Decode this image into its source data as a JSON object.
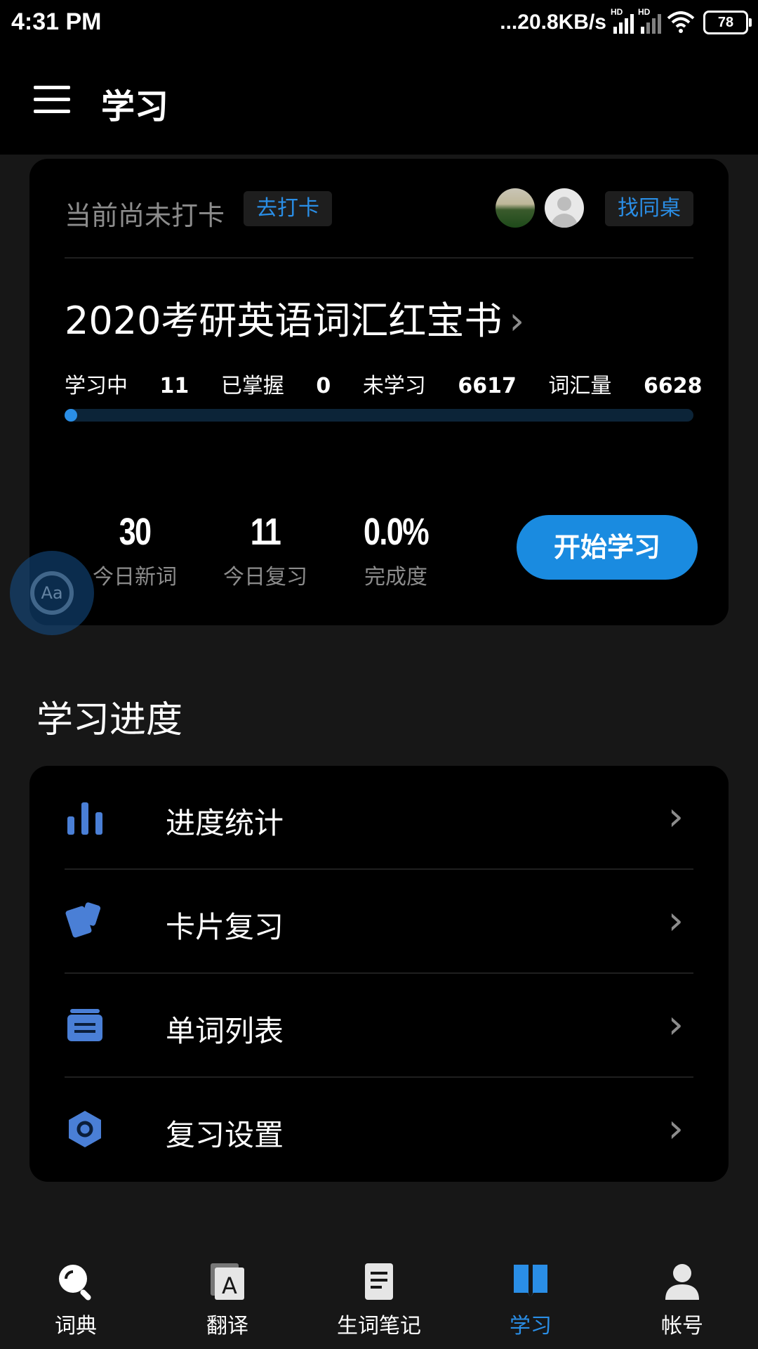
{
  "status_bar": {
    "time": "4:31 PM",
    "network_speed": "...20.8KB/s",
    "signal_label_1": "HD",
    "signal_label_2": "HD",
    "battery": "78",
    "icons": [
      "signal-icon",
      "signal-icon",
      "wifi-icon",
      "battery-icon"
    ]
  },
  "app_bar": {
    "title": "学习",
    "menu_icon": "menu-icon"
  },
  "study_card": {
    "checkin_status": "当前尚未打卡",
    "checkin_button": "去打卡",
    "find_partner_button": "找同桌",
    "book_title": "2020考研英语词汇红宝书",
    "book_chevron": "›",
    "stats": {
      "learning_label": "学习中",
      "learning_value": "11",
      "mastered_label": "已掌握",
      "mastered_value": "0",
      "unlearned_label": "未学习",
      "unlearned_value": "6617",
      "vocab_label": "词汇量",
      "vocab_value": "6628"
    },
    "progress_fraction": 0.0,
    "metrics": [
      {
        "value": "30",
        "label": "今日新词"
      },
      {
        "value": "11",
        "label": "今日复习"
      },
      {
        "value": "0.0%",
        "label": "完成度"
      }
    ],
    "start_button": "开始学习"
  },
  "progress_section": {
    "title": "学习进度",
    "items": [
      {
        "label": "进度统计",
        "icon": "bar-chart-icon"
      },
      {
        "label": "卡片复习",
        "icon": "cards-icon"
      },
      {
        "label": "单词列表",
        "icon": "list-icon"
      },
      {
        "label": "复习设置",
        "icon": "hexagon-settings-icon"
      }
    ],
    "chevron": "›"
  },
  "floating_button": {
    "icon": "search-aa-icon",
    "text": "Aa"
  },
  "bottom_nav": {
    "items": [
      {
        "label": "词典",
        "icon": "search-icon",
        "active": false
      },
      {
        "label": "翻译",
        "icon": "translate-icon",
        "active": false
      },
      {
        "label": "生词笔记",
        "icon": "notes-icon",
        "active": false
      },
      {
        "label": "学习",
        "icon": "book-icon",
        "active": true
      },
      {
        "label": "帐号",
        "icon": "person-icon",
        "active": false
      }
    ]
  },
  "colors": {
    "accent": "#2a8ee6",
    "background": "#171717",
    "card": "#000000"
  }
}
